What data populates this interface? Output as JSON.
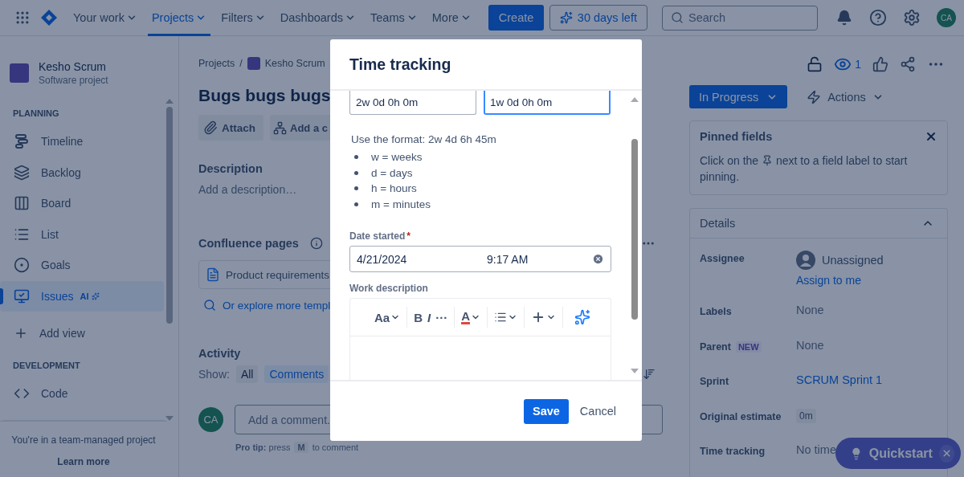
{
  "nav": {
    "items": [
      {
        "label": "Your work",
        "selected": false
      },
      {
        "label": "Projects",
        "selected": true
      },
      {
        "label": "Filters",
        "selected": false
      },
      {
        "label": "Dashboards",
        "selected": false
      },
      {
        "label": "Teams",
        "selected": false
      },
      {
        "label": "More",
        "selected": false
      }
    ],
    "create": "Create",
    "trial": "30 days left",
    "search": {
      "placeholder": "Search"
    },
    "avatar": "CA"
  },
  "sidebar": {
    "project": {
      "name": "Kesho Scrum",
      "type": "Software project"
    },
    "sections": [
      {
        "heading": "PLANNING",
        "items": [
          {
            "label": "Timeline",
            "selected": false
          },
          {
            "label": "Backlog",
            "selected": false
          },
          {
            "label": "Board",
            "selected": false
          },
          {
            "label": "List",
            "selected": false
          },
          {
            "label": "Goals",
            "selected": false
          },
          {
            "label": "Issues",
            "badge": "AI",
            "selected": true
          }
        ],
        "add_view": "Add view"
      },
      {
        "heading": "DEVELOPMENT",
        "items": [
          {
            "label": "Code",
            "selected": false
          }
        ]
      }
    ],
    "footer": {
      "text": "You're in a team-managed project",
      "link": "Learn more"
    }
  },
  "issue": {
    "breadcrumbs": [
      "Projects",
      "Kesho Scrum"
    ],
    "separator": "/",
    "title": "Bugs bugs bugs",
    "actions": [
      "Attach",
      "Add a c"
    ],
    "description": {
      "heading": "Description",
      "placeholder": "Add a description…"
    },
    "confluence": {
      "heading": "Confluence pages",
      "page": "Product requirements",
      "explore": "Or explore more templ"
    },
    "activity": {
      "heading": "Activity",
      "show_label": "Show:",
      "filters": [
        {
          "label": "All",
          "selected": false
        },
        {
          "label": "Comments",
          "selected": true
        }
      ],
      "avatar": "CA",
      "comment_placeholder": "Add a comment.",
      "tip": "**Pro tip:** press",
      "key": "M",
      "tip_end": "to comment"
    }
  },
  "side": {
    "watchers": "1",
    "status": "In Progress",
    "actions": "Actions",
    "pinned": {
      "title": "Pinned fields",
      "hint_start": "Click on the",
      "hint_middle": "next to a field label to start",
      "hint_end": "pinning."
    },
    "details": {
      "title": "Details",
      "expanded": true,
      "fields": [
        {
          "label": "Assignee",
          "kind": "person",
          "value": "Unassigned",
          "link": "Assign to me"
        },
        {
          "label": "Labels",
          "kind": "text",
          "value": "None"
        },
        {
          "label": "Parent",
          "badge": "NEW",
          "kind": "text",
          "value": "None"
        },
        {
          "label": "Sprint",
          "kind": "link",
          "value": "SCRUM Sprint 1"
        },
        {
          "label": "Original estimate",
          "kind": "pill",
          "value": "0m"
        },
        {
          "label": "Time tracking",
          "kind": "text",
          "value": "No time"
        }
      ]
    }
  },
  "quickstart": {
    "label": "Quickstart"
  },
  "modal": {
    "title": "Time tracking",
    "inputs": [
      {
        "value": "2w 0d 0h 0m",
        "focused": false
      },
      {
        "value": "1w 0d 0h 0m",
        "focused": true
      }
    ],
    "help": "Use the format: 2w 4d 6h 45m",
    "units": [
      "w = weeks",
      "d = days",
      "h = hours",
      "m = minutes"
    ],
    "date": {
      "label": "Date started",
      "required_mark": "*",
      "date": "4/21/2024",
      "time": "9:17 AM"
    },
    "work": {
      "label": "Work description",
      "tool_groups": [
        [
          {
            "kind": "menu",
            "label": "Aa"
          }
        ],
        [
          {
            "kind": "bold",
            "label": "B"
          },
          {
            "kind": "italic",
            "label": "I"
          },
          {
            "kind": "more",
            "label": "···"
          }
        ],
        [
          {
            "kind": "color",
            "label": "A"
          }
        ],
        [
          {
            "kind": "list"
          }
        ],
        [
          {
            "kind": "insert"
          }
        ],
        [
          {
            "kind": "ai"
          }
        ]
      ]
    },
    "save": "Save",
    "cancel": "Cancel"
  }
}
